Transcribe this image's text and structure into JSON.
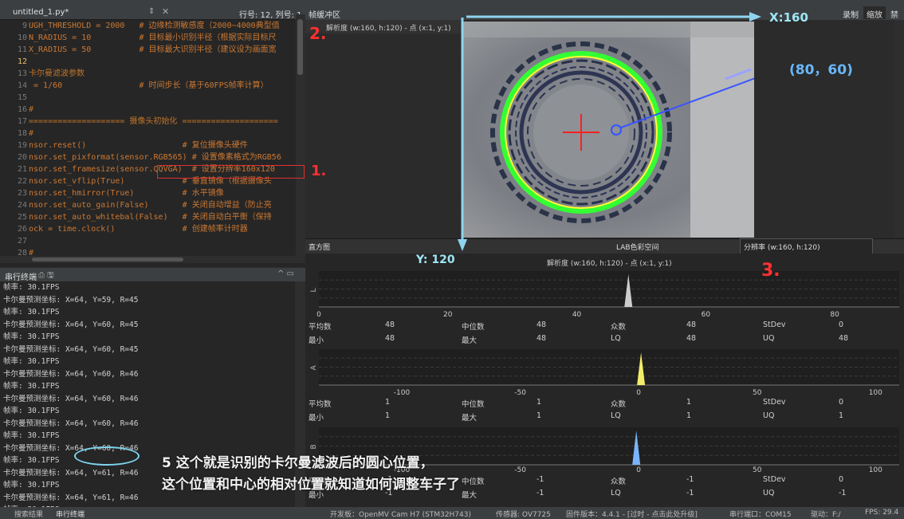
{
  "editor": {
    "tab_name": "untitled_1.py*",
    "tab_arrows": "⇕",
    "close_glyph": "✕",
    "cursor_pos": "行号: 12, 列号: 1",
    "lines": [
      {
        "n": "9",
        "t": "UGH_THRESHOLD = 2000   # 边缘检测敏感度（2000~4000典型值",
        "cls": "cx"
      },
      {
        "n": "10",
        "t": "N_RADIUS = 10          # 目标最小识别半径（根据实际目标尺",
        "cls": "cx"
      },
      {
        "n": "11",
        "t": "X_RADIUS = 50          # 目标最大识别半径（建议设为画面宽",
        "cls": "cx"
      },
      {
        "n": "12",
        "t": "",
        "cls": "cx"
      },
      {
        "n": "13",
        "t": "卡尔曼滤波参数",
        "cls": "cm"
      },
      {
        "n": "14",
        "t": " = 1/60                # 时间步长（基于60FPS帧率计算）",
        "cls": "cx"
      },
      {
        "n": "15",
        "t": "",
        "cls": "cx"
      },
      {
        "n": "16",
        "t": "#",
        "cls": "cm"
      },
      {
        "n": "17",
        "t": "==================== 摄像头初始化 ====================",
        "cls": "cm"
      },
      {
        "n": "18",
        "t": "#",
        "cls": "cm"
      },
      {
        "n": "19",
        "t": "nsor.reset()                    # 复位摄像头硬件",
        "cls": "cx"
      },
      {
        "n": "20",
        "t": "nsor.set_pixformat(sensor.RGB565) # 设置像素格式为RGB56",
        "cls": "cx"
      },
      {
        "n": "21",
        "t": "nsor.set_framesize(sensor.QQVGA)  # 设置分辨率160x120",
        "cls": "cx"
      },
      {
        "n": "22",
        "t": "nsor.set_vflip(True)            # 垂直镜像（根据摄像头",
        "cls": "cx"
      },
      {
        "n": "23",
        "t": "nsor.set_hmirror(True)          # 水平镜像",
        "cls": "cx"
      },
      {
        "n": "24",
        "t": "nsor.set_auto_gain(False)       # 关闭自动增益（防止亮",
        "cls": "cx"
      },
      {
        "n": "25",
        "t": "nsor.set_auto_whitebal(False)   # 关闭自动白平衡（保持",
        "cls": "cx"
      },
      {
        "n": "26",
        "t": "ock = time.clock()              # 创建帧率计时器",
        "cls": "cx"
      },
      {
        "n": "27",
        "t": "",
        "cls": "cx"
      },
      {
        "n": "28",
        "t": "#",
        "cls": "cm"
      }
    ],
    "current_line": "12"
  },
  "serial": {
    "title": "串行终端",
    "icons": "⎙  🖫",
    "ctrl": "^  ▭",
    "lines": [
      "帧率: 30.1FPS",
      "卡尔曼预测坐标: X=64, Y=59, R=45",
      "帧率: 30.1FPS",
      "卡尔曼预测坐标: X=64, Y=60, R=45",
      "帧率: 30.1FPS",
      "卡尔曼预测坐标: X=64, Y=60, R=45",
      "帧率: 30.1FPS",
      "卡尔曼预测坐标: X=64, Y=60, R=46",
      "帧率: 30.1FPS",
      "卡尔曼预测坐标: X=64, Y=60, R=46",
      "帧率: 30.1FPS",
      "卡尔曼预测坐标: X=64, Y=60, R=46",
      "帧率: 30.1FPS",
      "卡尔曼预测坐标: X=64, Y=60, R=46",
      "帧率: 30.1FPS",
      "卡尔曼预测坐标: X=64, Y=61, R=46",
      "帧率: 30.1FPS",
      "卡尔曼预测坐标: X=64, Y=61, R=46",
      "帧率: 30.1FPS"
    ]
  },
  "status": {
    "search_results": "搜索结果",
    "serial_terminal": "串行终端",
    "board": "开发板：OpenMV Cam H7 (STM32H743)",
    "sensor": "传感器: OV7725",
    "firmware": "固件版本：4.4.1 - [过时 - 点击此处升级]",
    "port": "串行端口：COM15",
    "drive": "驱动：F:/",
    "fps": "FPS: 29.4"
  },
  "framebuffer": {
    "title": "帧缓冲区",
    "record": "录制",
    "zoom": "缩放",
    "disable": "禁用",
    "tab_label": "解析度 (w:160, h:120) - 点 (x:1, y:1)"
  },
  "histogram": {
    "title": "直方图",
    "colorspace": "LAB色彩空间",
    "resolution": "分辨率 (w:160, h:120)",
    "subtitle": "解析度 (w:160, h:120) - 点 (x:1, y:1)",
    "channels": [
      {
        "name": "L",
        "ticks": [
          "0",
          "20",
          "40",
          "60",
          "80"
        ],
        "peak_value": 48,
        "color": "#cccccc",
        "stats_row1": [
          "平均数",
          "48",
          "中位数",
          "48",
          "众数",
          "48",
          "StDev",
          "0"
        ],
        "stats_row2": [
          "最小",
          "48",
          "最大",
          "48",
          "LQ",
          "48",
          "UQ",
          "48"
        ]
      },
      {
        "name": "A",
        "ticks": [
          "-100",
          "-50",
          "0",
          "50",
          "100"
        ],
        "peak_value": 1,
        "color": "#f2ec6a",
        "stats_row1": [
          "平均数",
          "1",
          "中位数",
          "1",
          "众数",
          "1",
          "StDev",
          "0"
        ],
        "stats_row2": [
          "最小",
          "1",
          "最大",
          "1",
          "LQ",
          "1",
          "UQ",
          "1"
        ]
      },
      {
        "name": "B",
        "ticks": [
          "-100",
          "-50",
          "0",
          "50",
          "100"
        ],
        "peak_value": -1,
        "color": "#7ab4ff",
        "stats_row1": [
          "平均数",
          "-1",
          "中位数",
          "-1",
          "众数",
          "-1",
          "StDev",
          "0"
        ],
        "stats_row2": [
          "最小",
          "-1",
          "最大",
          "-1",
          "LQ",
          "-1",
          "UQ",
          "-1"
        ]
      }
    ]
  },
  "annotations": {
    "label_1": "1.",
    "label_2": "2.",
    "label_3": "3.",
    "x_label": "X:160",
    "y_label": "Y: 120",
    "center": "(80，60)",
    "note_line1": "5 这个就是识别的卡尔曼滤波后的圆心位置，",
    "note_line2": "这个位置和中心的相对位置就知道如何调整车子了"
  },
  "colors": {
    "annotation_red": "#ff3030",
    "annotation_blue": "#6ab7ff",
    "annotation_cyan": "#9fe6f5",
    "circle_green": "#33ff33",
    "circle_yellow": "#ffff33"
  }
}
